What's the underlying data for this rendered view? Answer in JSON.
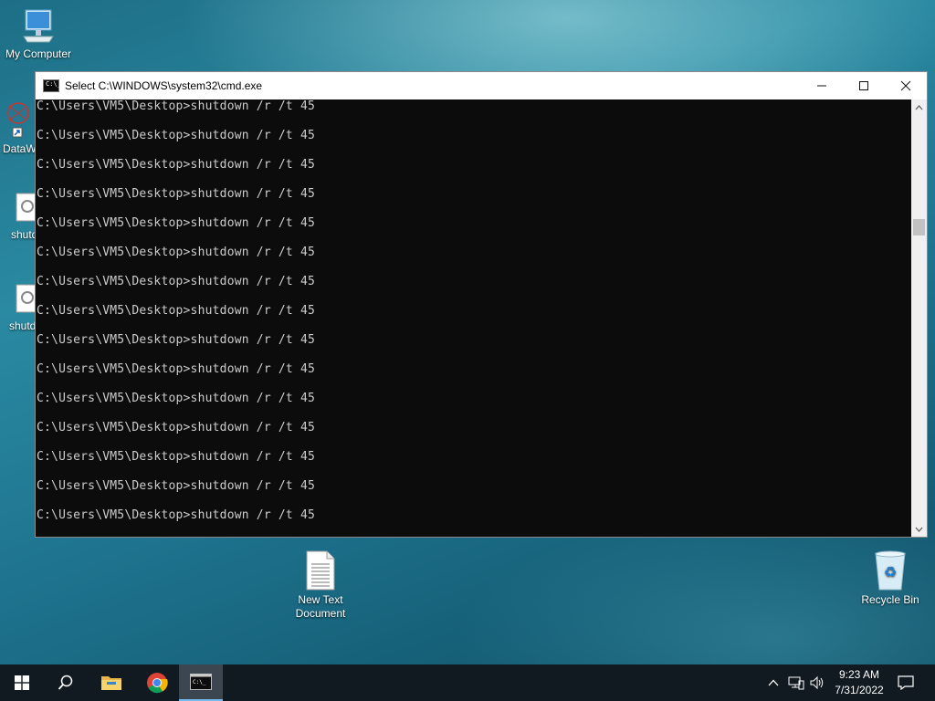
{
  "desktop": {
    "icons": [
      {
        "label": "My Computer"
      },
      {
        "label": "DataW"
      },
      {
        "label": "shutd"
      },
      {
        "label": "shutd"
      },
      {
        "label": "New Text Document"
      },
      {
        "label": "Recycle Bin"
      }
    ]
  },
  "window": {
    "title": "Select C:\\WINDOWS\\system32\\cmd.exe",
    "minimize_glyph": "—",
    "maximize_glyph": "☐",
    "close_glyph": "✕",
    "console_lines": [
      "C:\\Users\\VM5\\Desktop>shutdown /r /t 45",
      "C:\\Users\\VM5\\Desktop>shutdown /r /t 45",
      "C:\\Users\\VM5\\Desktop>shutdown /r /t 45",
      "C:\\Users\\VM5\\Desktop>shutdown /r /t 45",
      "C:\\Users\\VM5\\Desktop>shutdown /r /t 45",
      "C:\\Users\\VM5\\Desktop>shutdown /r /t 45",
      "C:\\Users\\VM5\\Desktop>shutdown /r /t 45",
      "C:\\Users\\VM5\\Desktop>shutdown /r /t 45",
      "C:\\Users\\VM5\\Desktop>shutdown /r /t 45",
      "C:\\Users\\VM5\\Desktop>shutdown /r /t 45",
      "C:\\Users\\VM5\\Desktop>shutdown /r /t 45",
      "C:\\Users\\VM5\\Desktop>shutdown /r /t 45",
      "C:\\Users\\VM5\\Desktop>shutdown /r /t 45",
      "C:\\Users\\VM5\\Desktop>shutdown /r /t 45",
      "C:\\Users\\VM5\\Desktop>shutdown /r /t 45"
    ],
    "colors": {
      "console_bg": "#0c0c0c",
      "console_text": "#cccccc"
    }
  },
  "taskbar": {
    "items": [
      {
        "icon": "windows-start-icon"
      },
      {
        "icon": "search-icon"
      },
      {
        "icon": "file-explorer-icon"
      },
      {
        "icon": "chrome-icon"
      },
      {
        "icon": "cmd-icon",
        "active": true
      }
    ],
    "tray": {
      "icons": [
        "chevron-up-icon",
        "network-icon",
        "volume-icon"
      ],
      "time": "9:23 AM",
      "date": "7/31/2022",
      "notification_icon": "action-center-icon"
    },
    "accent": "#76b9ed"
  }
}
